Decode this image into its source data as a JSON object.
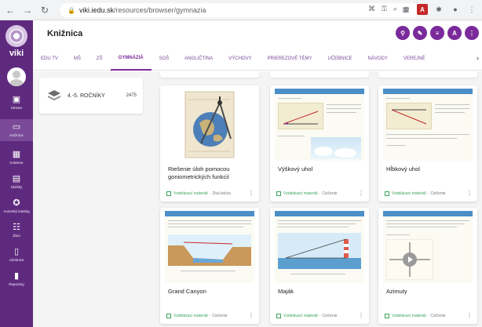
{
  "browser": {
    "url_domain": "viki.iedu.sk",
    "url_path": "/resources/browser/gymnazia"
  },
  "sidebar": {
    "brand": "viki",
    "items": [
      {
        "label": "Stream",
        "icon": "stream-icon"
      },
      {
        "label": "Knižnica",
        "icon": "library-icon",
        "active": true
      },
      {
        "label": "Kolekcie",
        "icon": "collections-icon"
      },
      {
        "label": "Skúšky",
        "icon": "exams-icon"
      },
      {
        "label": "Autorský katalóg",
        "icon": "author-catalog-icon"
      },
      {
        "label": "Žiaci",
        "icon": "students-icon"
      },
      {
        "label": "Učebnice",
        "icon": "textbooks-icon"
      },
      {
        "label": "Reporting",
        "icon": "reporting-icon"
      }
    ]
  },
  "header": {
    "title": "Knižnica",
    "actions": [
      {
        "icon": "search-icon",
        "glyph": "⚲"
      },
      {
        "icon": "edit-icon",
        "glyph": "✎"
      },
      {
        "icon": "filter-icon",
        "glyph": "≡"
      },
      {
        "icon": "translate-icon",
        "glyph": "A"
      },
      {
        "icon": "more-icon",
        "glyph": "⋮"
      }
    ]
  },
  "tabs": [
    {
      "label": "EDU TV"
    },
    {
      "label": "MŠ"
    },
    {
      "label": "ZŠ"
    },
    {
      "label": "GYMNÁZIÁ",
      "active": true
    },
    {
      "label": "SOŠ"
    },
    {
      "label": "ANGLIČTINA"
    },
    {
      "label": "VÝCHOVY"
    },
    {
      "label": "PRIEREZOVÉ TÉMY"
    },
    {
      "label": "UČEBNICE"
    },
    {
      "label": "NÁVODY"
    },
    {
      "label": "VEREJNÉ"
    }
  ],
  "filter": {
    "label": "4.-5. ROČNÍKY",
    "count": "2475"
  },
  "cards": [
    {
      "title": "Riešenie úloh pomocou goniometrických funkcií",
      "type": "Vzdelávací materiál",
      "subtype": "Živá lekcia"
    },
    {
      "title": "Výškový uhol",
      "type": "Vzdelávací materiál",
      "subtype": "Cvičenie"
    },
    {
      "title": "Hĺbkový uhol",
      "type": "Vzdelávací materiál",
      "subtype": "Cvičenie"
    },
    {
      "title": "Grand Canyon",
      "type": "Vzdelávací materiál",
      "subtype": "Cvičenie"
    },
    {
      "title": "Maják",
      "type": "Vzdelávací materiál",
      "subtype": "Cvičenie"
    },
    {
      "title": "Azimuty",
      "type": "Vzdelávací materiál",
      "subtype": "Cvičenie"
    }
  ],
  "colors": {
    "sidebar": "#5e2a7e",
    "accent": "#7a2a9a",
    "material_green": "#3aa35a"
  }
}
